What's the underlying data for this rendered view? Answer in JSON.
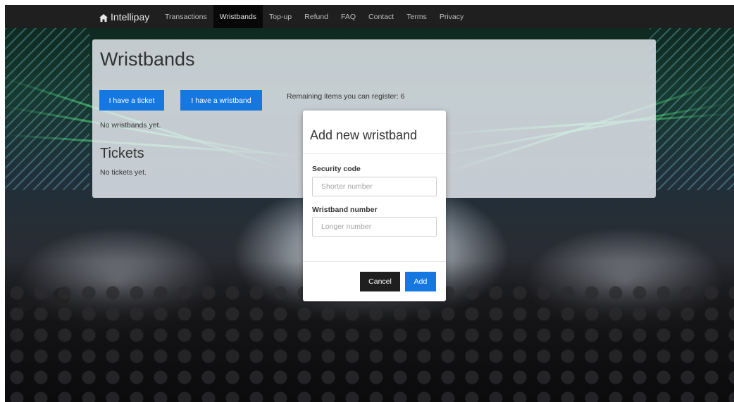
{
  "nav": {
    "brand": "Intellipay",
    "brand_icon": "home-icon",
    "items": [
      {
        "label": "Transactions",
        "active": false
      },
      {
        "label": "Wristbands",
        "active": true
      },
      {
        "label": "Top-up",
        "active": false
      },
      {
        "label": "Refund",
        "active": false
      },
      {
        "label": "FAQ",
        "active": false
      },
      {
        "label": "Contact",
        "active": false
      },
      {
        "label": "Terms",
        "active": false
      },
      {
        "label": "Privacy",
        "active": false
      }
    ]
  },
  "main": {
    "title": "Wristbands",
    "ticket_button": "I have a ticket",
    "wristband_button": "I have a wristband",
    "remaining_text": "Remaining items you can register: 6",
    "no_wristbands": "No wristbands yet.",
    "tickets_title": "Tickets",
    "no_tickets": "No tickets yet."
  },
  "modal": {
    "title": "Add new wristband",
    "security_label": "Security code",
    "security_placeholder": "Shorter number",
    "security_value": "",
    "wristband_label": "Wristband number",
    "wristband_placeholder": "Longer number",
    "wristband_value": "",
    "cancel_label": "Cancel",
    "add_label": "Add"
  },
  "colors": {
    "accent": "#1577e0",
    "navbar": "#1f1f1f",
    "cancel": "#1f1f1f"
  }
}
